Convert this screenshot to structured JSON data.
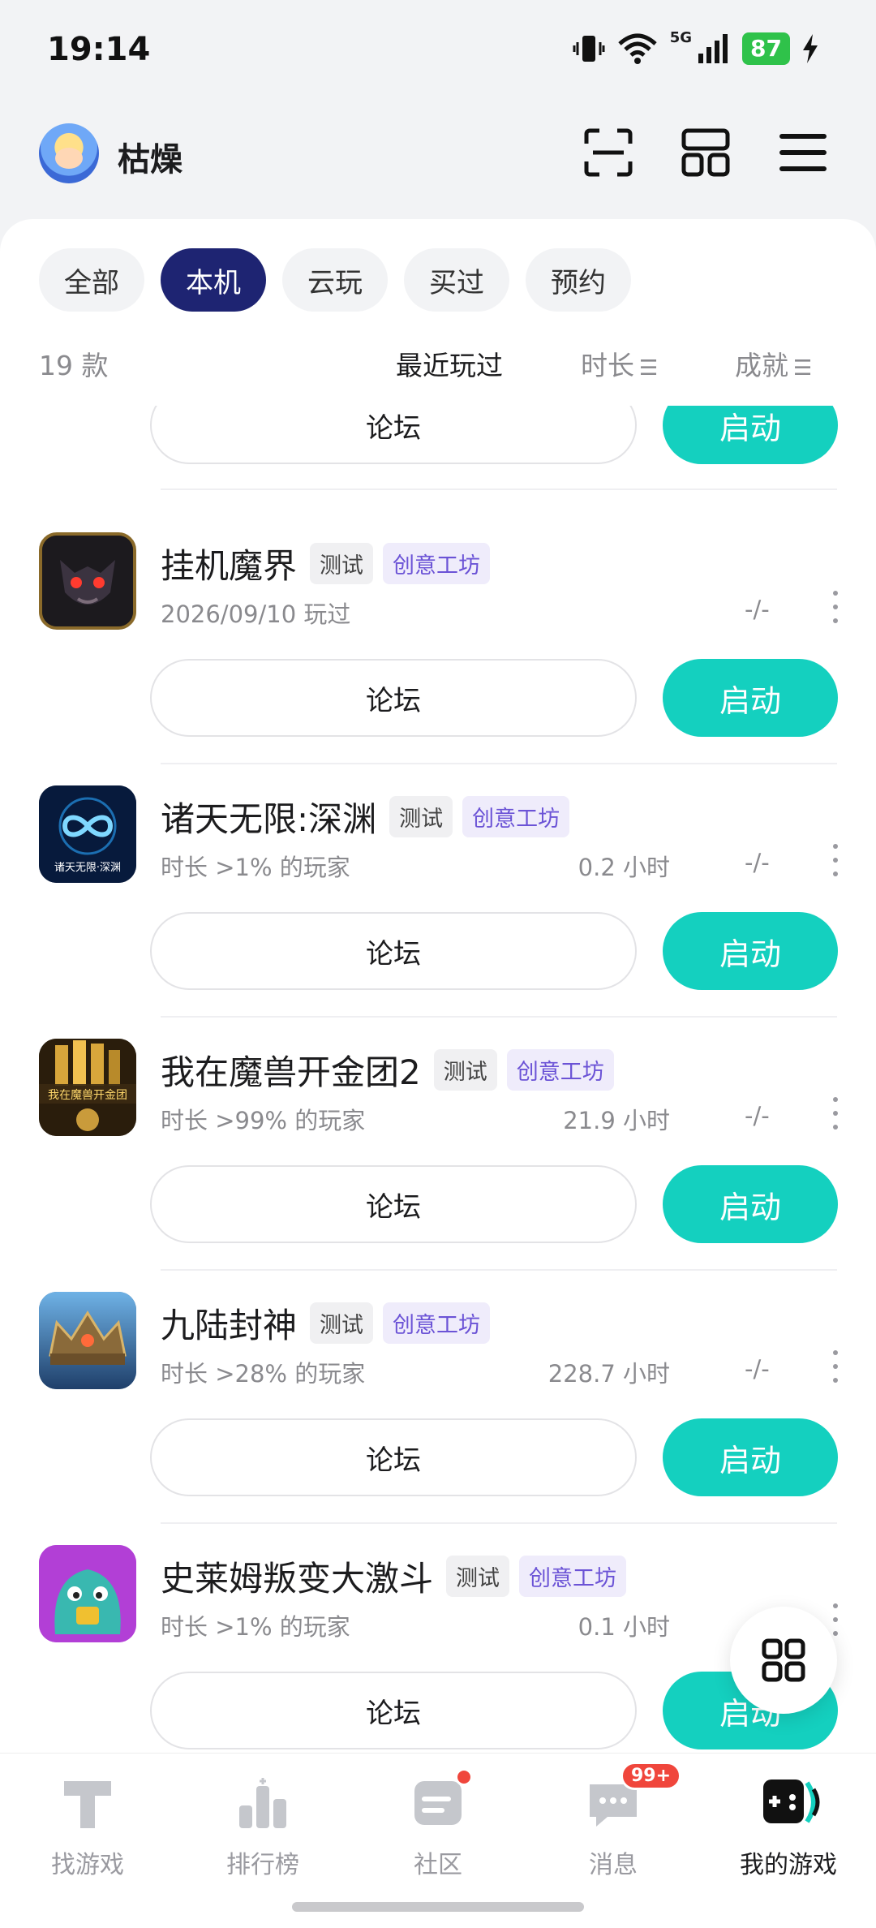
{
  "status": {
    "time": "19:14",
    "battery": "87",
    "network": "5G"
  },
  "header": {
    "username": "枯燥"
  },
  "filters": [
    "全部",
    "本机",
    "云玩",
    "买过",
    "预约"
  ],
  "sortbar": {
    "count": "19 款",
    "recent": "最近玩过",
    "duration": "时长",
    "achievement": "成就"
  },
  "buttons": {
    "forum": "论坛",
    "start": "启动"
  },
  "tags": {
    "test": "测试",
    "creative": "创意工坊"
  },
  "games": [
    {
      "name": "挂机魔界",
      "sub": "2026/09/10 玩过",
      "hours": "",
      "ach": "-/-"
    },
    {
      "name": "诸天无限:深渊",
      "sub": "时长 >1% 的玩家",
      "hours": "0.2 小时",
      "ach": "-/-",
      "icon_text": "诸天无限·深渊"
    },
    {
      "name": "我在魔兽开金团2",
      "sub": "时长 >99% 的玩家",
      "hours": "21.9 小时",
      "ach": "-/-",
      "icon_text": "我在魔兽开金团"
    },
    {
      "name": "九陆封神",
      "sub": "时长 >28% 的玩家",
      "hours": "228.7 小时",
      "ach": "-/-"
    },
    {
      "name": "史莱姆叛变大激斗",
      "sub": "时长 >1% 的玩家",
      "hours": "0.1 小时",
      "ach": ""
    }
  ],
  "nav": [
    {
      "label": "找游戏",
      "icon": "find-game-icon"
    },
    {
      "label": "排行榜",
      "icon": "ranking-icon"
    },
    {
      "label": "社区",
      "icon": "community-icon"
    },
    {
      "label": "消息",
      "icon": "message-icon",
      "badge": "99+"
    },
    {
      "label": "我的游戏",
      "icon": "my-games-icon"
    }
  ],
  "colors": {
    "accent": "#14d0bf",
    "chip_active": "#1e2472",
    "creative_tag": "#6b53d6",
    "badge": "#f0463c"
  }
}
